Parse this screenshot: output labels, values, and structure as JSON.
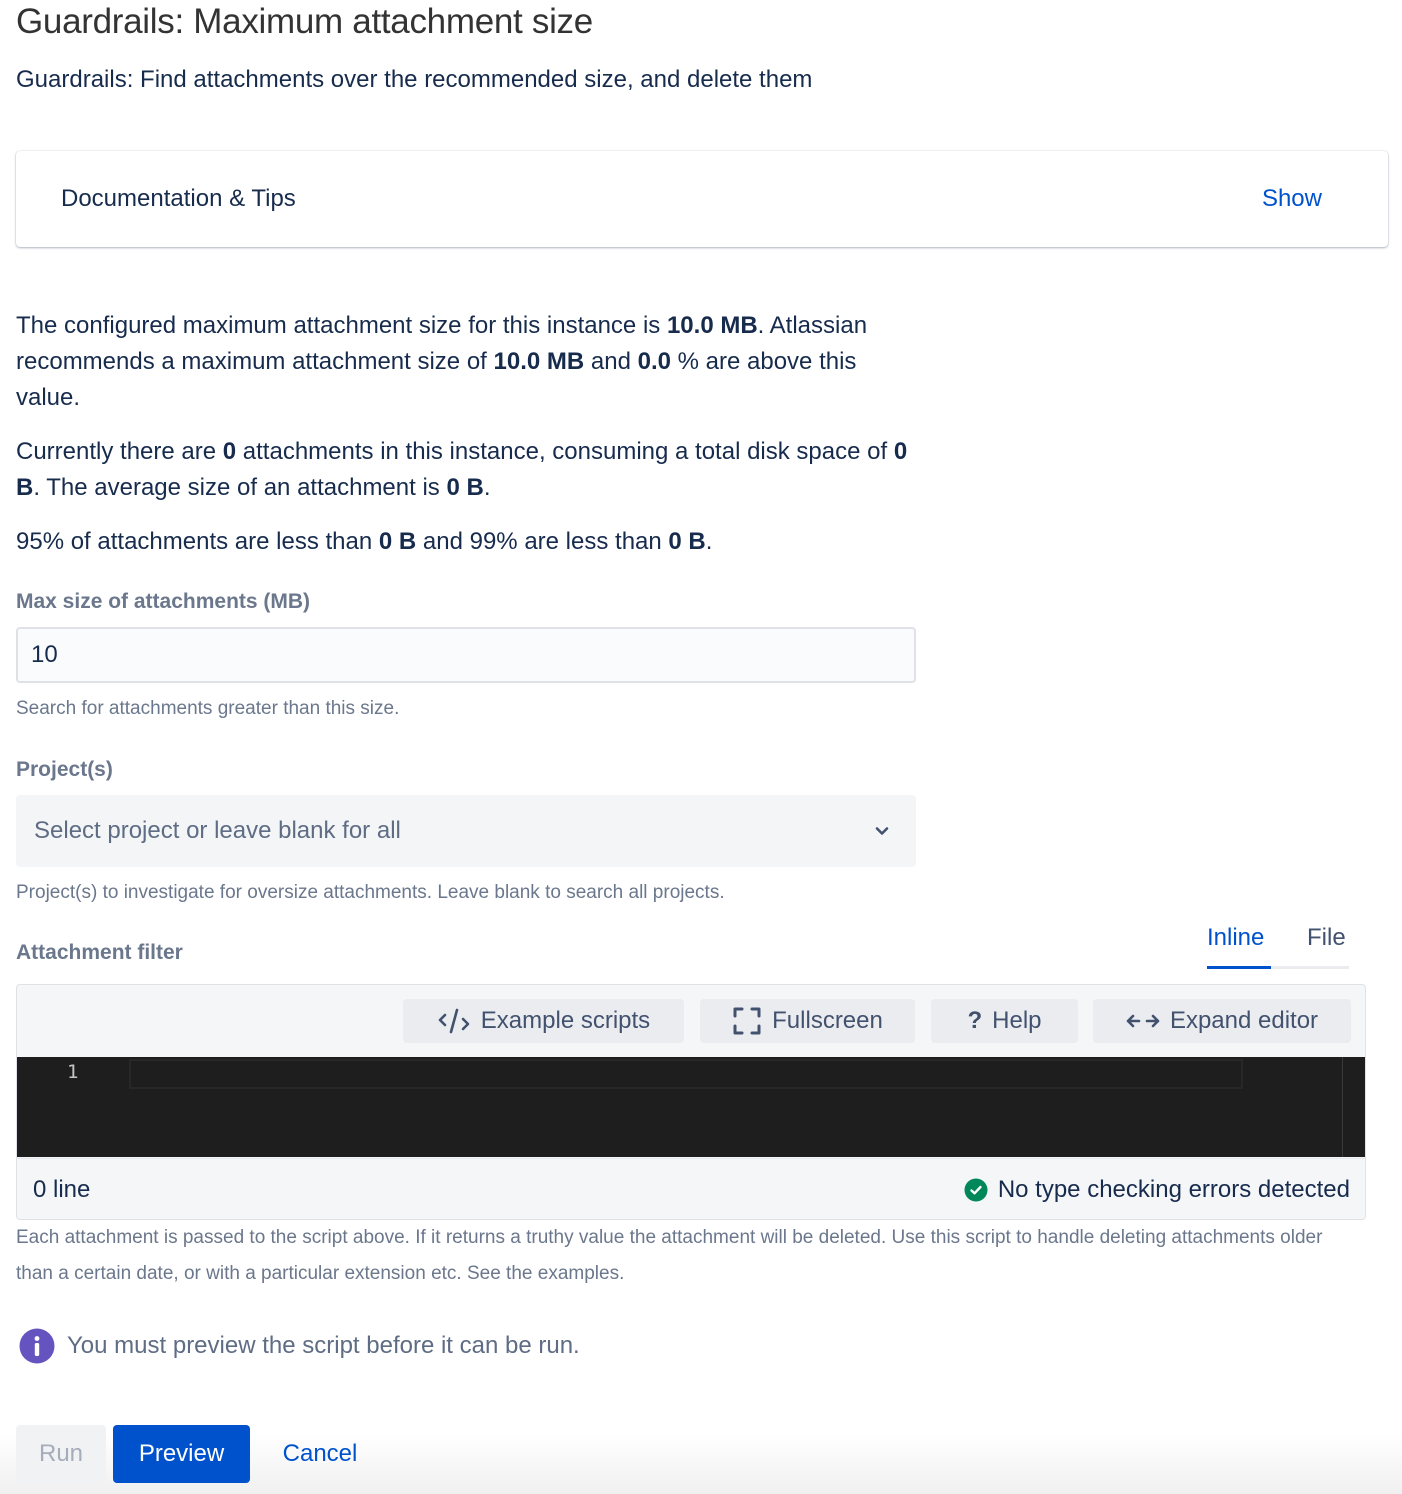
{
  "page": {
    "title": "Guardrails: Maximum attachment size",
    "subtitle": "Guardrails: Find attachments over the recommended size, and delete them"
  },
  "documentation": {
    "title": "Documentation & Tips",
    "toggle_label": "Show"
  },
  "stats": {
    "p1": {
      "t1": "The configured maximum attachment size for this instance is ",
      "configured_max": "10.0 MB",
      "t2": ". Atlassian recommends a maximum attachment size of ",
      "recommended_max": "10.0 MB",
      "t3": " and ",
      "percent_above": "0.0",
      "t4": " % are above this value."
    },
    "p2": {
      "t1": "Currently there are ",
      "attachment_count": "0",
      "t2": " attachments in this instance, consuming a total disk space of ",
      "total_disk": "0 B",
      "t3": ". The average size of an attachment is ",
      "average_size": "0 B",
      "t4": "."
    },
    "p3": {
      "t1": "95% of attachments are less than ",
      "p95": "0 B",
      "t2": " and 99% are less than ",
      "p99": "0 B",
      "t3": "."
    }
  },
  "max_size_field": {
    "label": "Max size of attachments (MB)",
    "value": "10",
    "help": "Search for attachments greater than this size."
  },
  "projects_field": {
    "label": "Project(s)",
    "placeholder": "Select project or leave blank for all",
    "help": "Project(s) to investigate for oversize attachments. Leave blank to search all projects."
  },
  "attachment_filter": {
    "label": "Attachment filter",
    "tabs": [
      {
        "label": "Inline",
        "active": true
      },
      {
        "label": "File",
        "active": false
      }
    ],
    "toolbar": {
      "example_scripts": {
        "label": "Example scripts",
        "icon": "code-icon"
      },
      "fullscreen": {
        "label": "Fullscreen",
        "icon": "fullscreen-icon"
      },
      "help": {
        "label": "Help",
        "icon": "question-icon"
      },
      "expand_editor": {
        "label": "Expand editor",
        "icon": "expand-arrows-icon"
      }
    },
    "editor": {
      "line_numbers": [
        "1"
      ],
      "code": ""
    },
    "status": {
      "line_count": "0 line",
      "type_check": "No type checking errors detected"
    },
    "help": "Each attachment is passed to the script above. If it returns a truthy value the attachment will be deleted. Use this script to handle deleting attachments older than a certain date, or with a particular extension etc. See the examples."
  },
  "notice": {
    "text": "You must preview the script before it can be run.",
    "icon": "info-icon"
  },
  "actions": {
    "run": "Run",
    "preview": "Preview",
    "cancel": "Cancel"
  },
  "colors": {
    "primary": "#0052cc",
    "text": "#172b4d",
    "subtle_text": "#6b778c",
    "success": "#00875a",
    "info": "#6554c0",
    "editor_bg": "#1e1e1e"
  }
}
